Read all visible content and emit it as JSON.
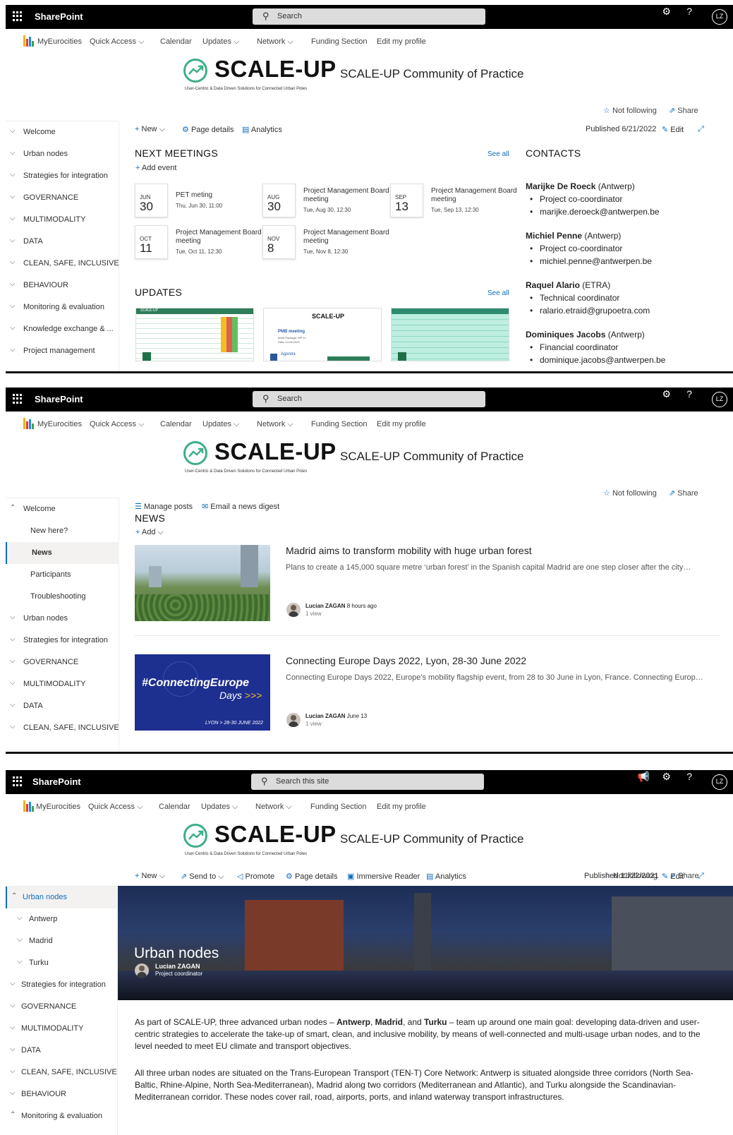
{
  "suitebar": {
    "app_name": "SharePoint",
    "search_placeholder": "Search",
    "search_placeholder_site": "Search this site",
    "avatar_initials": "LZ"
  },
  "topnav": {
    "items": [
      "MyEurocities",
      "Quick Access",
      "Calendar",
      "Updates",
      "Network",
      "Funding Section",
      "Edit my profile"
    ]
  },
  "banner": {
    "logo_text": "SCALE-UP",
    "tagline": "User-Centric & Data Driven Solutions for Connected Urban Poles",
    "site_title": "SCALE-UP Community of Practice"
  },
  "follow": {
    "not_following": "Not following",
    "share": "Share"
  },
  "panel1": {
    "nav": [
      "Welcome",
      "Urban nodes",
      "Strategies for integration",
      "GOVERNANCE",
      "MULTIMODALITY",
      "DATA",
      "CLEAN, SAFE, INCLUSIVE",
      "BEHAVIOUR",
      "Monitoring & evaluation",
      "Knowledge exchange & ...",
      "Project management"
    ],
    "cmd": {
      "new": "New",
      "page_details": "Page details",
      "analytics": "Analytics",
      "published": "Published 6/21/2022",
      "edit": "Edit"
    },
    "meetings": {
      "title": "NEXT MEETINGS",
      "see_all": "See all",
      "add_event": "Add event",
      "events": [
        {
          "month": "JUN",
          "day": "30",
          "title": "PET meting",
          "time": "Thu, Jun 30, 11:00"
        },
        {
          "month": "AUG",
          "day": "30",
          "title": "Project Management Board meeting",
          "time": "Tue, Aug 30, 12:30"
        },
        {
          "month": "SEP",
          "day": "13",
          "title": "Project Management Board meeting",
          "time": "Tue, Sep 13, 12:30"
        },
        {
          "month": "OCT",
          "day": "11",
          "title": "Project Management Board meeting",
          "time": "Tue, Oct 11, 12:30"
        },
        {
          "month": "NOV",
          "day": "8",
          "title": "Project Management Board meeting",
          "time": "Tue, Nov 8, 12:30"
        }
      ]
    },
    "updates": {
      "title": "UPDATES",
      "see_all": "See all",
      "thumb2_logo": "SCALE-UP",
      "thumb2_heading": "PMB meeting",
      "thumb2_line1": "Work Package: WP 11",
      "thumb2_line2": "Date: 14.06.2022",
      "thumb2_agenda": "Agenda",
      "thumb1_header": "SCALE-UP"
    },
    "contacts": {
      "title": "CONTACTS",
      "people": [
        {
          "name": "Marijke De Roeck",
          "org": "(Antwerp)",
          "role": "Project co-coordinator",
          "email": "marijke.deroeck@antwerpen.be"
        },
        {
          "name": "Michiel Penne",
          "org": "(Antwerp)",
          "role": "Project co-coordinator",
          "email": "michiel.penne@antwerpen.be"
        },
        {
          "name": "Raquel Alario",
          "org": "(ETRA)",
          "role": "Technical coordinator",
          "email": "ralario.etraid@grupoetra.com"
        },
        {
          "name": "Dominiques Jacobs",
          "org": "(Antwerp)",
          "role": "Financial coordinator",
          "email": "dominique.jacobs@antwerpen.be"
        }
      ]
    }
  },
  "panel2": {
    "nav": [
      "Welcome",
      "New here?",
      "News",
      "Participants",
      "Troubleshooting",
      "Urban nodes",
      "Strategies for integration",
      "GOVERNANCE",
      "MULTIMODALITY",
      "DATA",
      "CLEAN, SAFE, INCLUSIVE"
    ],
    "cmd": {
      "manage_posts": "Manage posts",
      "email_digest": "Email a news digest"
    },
    "news": {
      "title": "NEWS",
      "add": "Add",
      "items": [
        {
          "title": "Madrid aims to transform mobility with huge urban forest",
          "desc": "Plans to create a 145,000 square metre ‘urban forest’ in the Spanish capital Madrid are one step closer after the city…",
          "author": "Lucian ZAGAN",
          "when": "8 hours ago",
          "views": "1 view"
        },
        {
          "title": "Connecting Europe Days 2022, Lyon, 28-30 June 2022",
          "desc": "Connecting Europe Days 2022, Europe's mobility flagship event, from 28 to 30 June in Lyon, France. Connecting Europ…",
          "author": "Lucian ZAGAN",
          "when": "June 13",
          "views": "1 view",
          "img_line1": "#ConnectingEurope",
          "img_line2": "Days",
          "img_footer": "LYON > 28-30 JUNE 2022"
        }
      ]
    }
  },
  "panel3": {
    "nav": [
      "Urban nodes",
      "Antwerp",
      "Madrid",
      "Turku",
      "Strategies for integration",
      "GOVERNANCE",
      "MULTIMODALITY",
      "DATA",
      "CLEAN, SAFE, INCLUSIVE",
      "BEHAVIOUR",
      "Monitoring & evaluation"
    ],
    "cmd": {
      "new": "New",
      "send_to": "Send to",
      "promote": "Promote",
      "page_details": "Page details",
      "immersive": "Immersive Reader",
      "analytics": "Analytics",
      "published": "Published 11/22/2021",
      "edit": "Edit"
    },
    "hero": {
      "title": "Urban nodes",
      "author": "Lucian ZAGAN",
      "role": "Project coordinator"
    },
    "para1": {
      "a": "As part of SCALE-UP, three advanced urban nodes – ",
      "b1": "Antwerp",
      "c": ", ",
      "b2": "Madrid",
      "d": ", and ",
      "b3": "Turku",
      "e": " – team up around one main goal: developing data-driven and user-centric strategies to accelerate the take-up of smart, clean, and inclusive mobility, by means of well-connected and multi-usage urban nodes, and to the level needed to meet EU climate and transport objectives."
    },
    "para2": "All three urban nodes are situated on the Trans-European Transport (TEN-T) Core Network: Antwerp is situated alongside three corridors (North Sea-Baltic, Rhine-Alpine, North Sea-Mediterranean), Madrid along two corridors (Mediterranean and Atlantic), and Turku alongside the Scandinavian-Mediterranean corridor. These nodes cover rail, road, airports, ports, and inland waterway transport infrastructures."
  }
}
